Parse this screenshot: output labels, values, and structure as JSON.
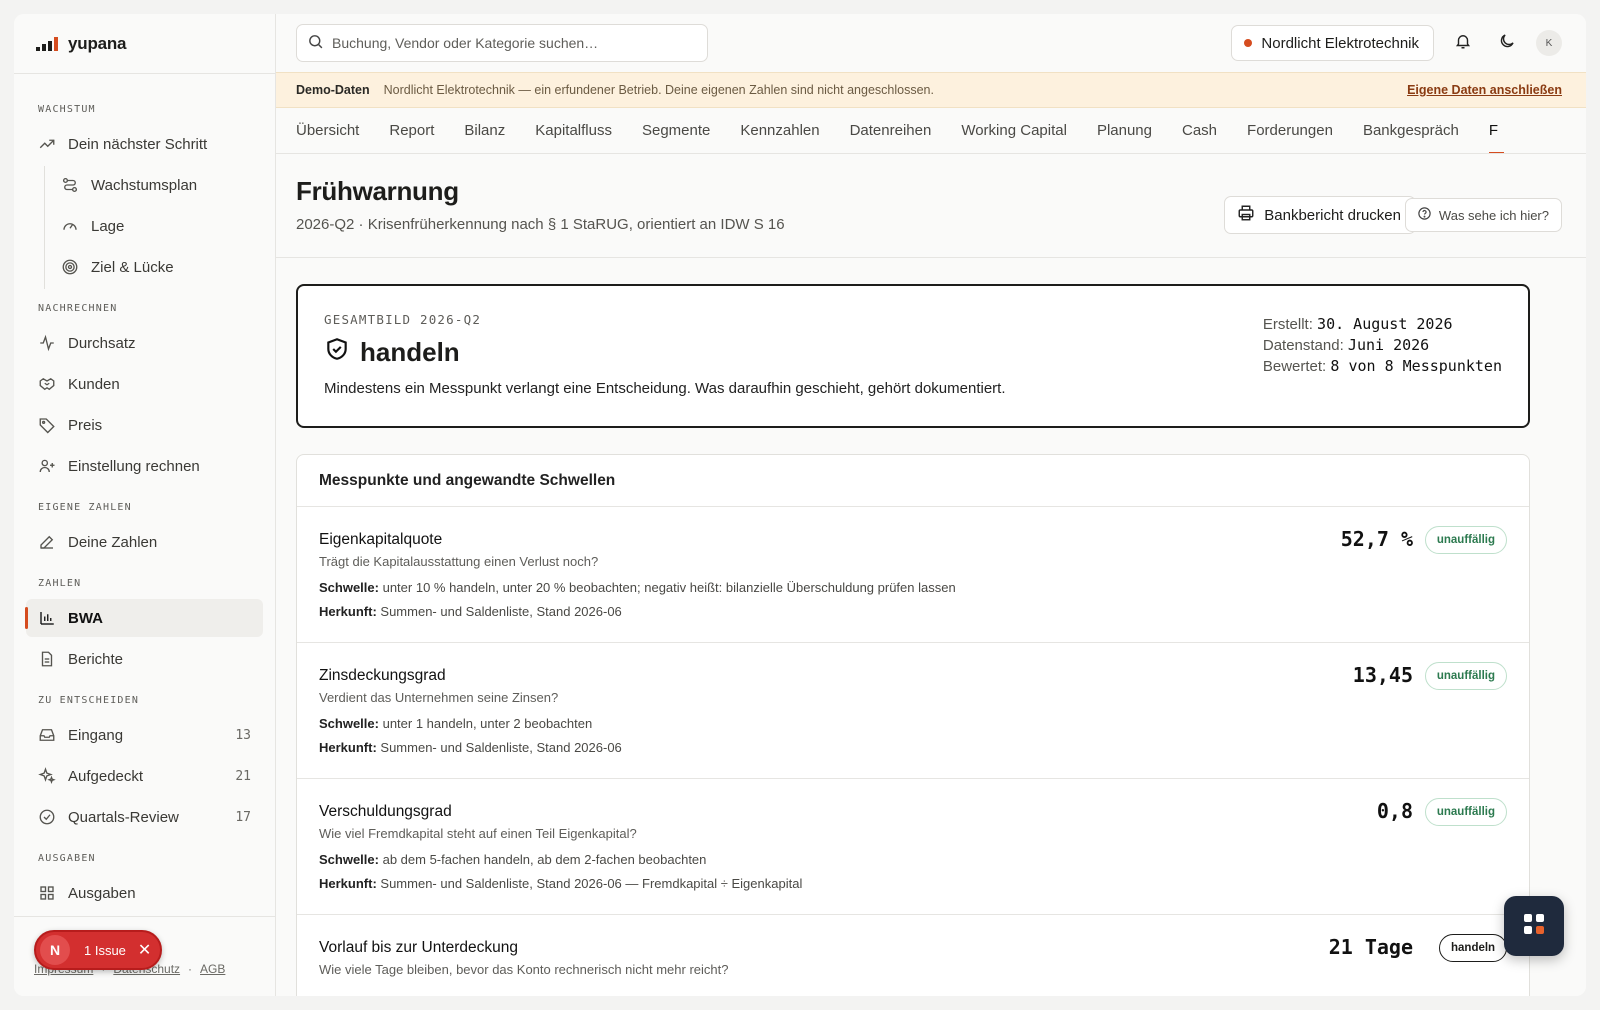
{
  "app": {
    "name": "yupana"
  },
  "search": {
    "placeholder": "Buchung, Vendor oder Kategorie suchen…"
  },
  "company": {
    "name": "Nordlicht Elektrotechnik"
  },
  "user": {
    "initials": "K"
  },
  "banner": {
    "badge": "Demo-Daten",
    "text": "Nordlicht Elektrotechnik — ein erfundener Betrieb. Deine eigenen Zahlen sind nicht angeschlossen.",
    "action": "Eigene Daten anschließen"
  },
  "sidebar": {
    "sections": {
      "wachstum": "WACHSTUM",
      "nachrechnen": "NACHRECHNEN",
      "eigene_zahlen": "EIGENE ZAHLEN",
      "zahlen": "ZAHLEN",
      "zu_entscheiden": "ZU ENTSCHEIDEN",
      "ausgaben": "AUSGABEN"
    },
    "items": {
      "next_step": "Dein nächster Schritt",
      "growth_plan": "Wachstumsplan",
      "lage": "Lage",
      "goal_gap": "Ziel & Lücke",
      "throughput": "Durchsatz",
      "customers": "Kunden",
      "price": "Preis",
      "hiring": "Einstellung rechnen",
      "own_numbers": "Deine Zahlen",
      "bwa": "BWA",
      "reports": "Berichte",
      "inbox": "Eingang",
      "inbox_count": "13",
      "uncovered": "Aufgedeckt",
      "uncovered_count": "21",
      "quarterly_review": "Quartals-Review",
      "quarterly_review_count": "17",
      "expenses": "Ausgaben"
    },
    "footer": {
      "link1": "Impressum",
      "link2": "Datenschutz",
      "sep": "·",
      "link3": "AGB"
    },
    "issue": {
      "letter": "N",
      "label": "1 Issue",
      "close": "✕"
    }
  },
  "tabs": [
    "Übersicht",
    "Report",
    "Bilanz",
    "Kapitalfluss",
    "Segmente",
    "Kennzahlen",
    "Datenreihen",
    "Working Capital",
    "Planung",
    "Cash",
    "Forderungen",
    "Bankgespräch",
    "F"
  ],
  "page": {
    "title": "Frühwarnung",
    "subtitle": "2026-Q2 · Krisenfrüherkennung nach § 1 StaRUG, orientiert an IDW S 16",
    "print_button": "Bankbericht drucken",
    "help_button": "Was sehe ich hier?"
  },
  "summary": {
    "kicker": "GESAMTBILD 2026-Q2",
    "verdict": "handeln",
    "description": "Mindestens ein Messpunkt verlangt eine Entscheidung. Was daraufhin geschieht, gehört dokumentiert.",
    "created_label": "Erstellt:",
    "created_value": "30. August 2026",
    "data_label": "Datenstand:",
    "data_value": "Juni 2026",
    "rated_label": "Bewertet:",
    "rated_value": "8 von 8 Messpunkten"
  },
  "measures": {
    "title": "Messpunkte und angewandte Schwellen",
    "threshold_label": "Schwelle:",
    "origin_label": "Herkunft:",
    "items": [
      {
        "name": "Eigenkapitalquote",
        "question": "Trägt die Kapitalausstattung einen Verlust noch?",
        "threshold": "unter 10 % handeln, unter 20 % beobachten; negativ heißt: bilanzielle Überschuldung prüfen lassen",
        "origin": "Summen- und Saldenliste, Stand 2026-06",
        "value": "52,7 %",
        "status": "unauffällig"
      },
      {
        "name": "Zinsdeckungsgrad",
        "question": "Verdient das Unternehmen seine Zinsen?",
        "threshold": "unter 1 handeln, unter 2 beobachten",
        "origin": "Summen- und Saldenliste, Stand 2026-06",
        "value": "13,45",
        "status": "unauffällig"
      },
      {
        "name": "Verschuldungsgrad",
        "question": "Wie viel Fremdkapital steht auf einen Teil Eigenkapital?",
        "threshold": "ab dem 5-fachen handeln, ab dem 2-fachen beobachten",
        "origin": "Summen- und Saldenliste, Stand 2026-06 — Fremdkapital ÷ Eigenkapital",
        "value": "0,8",
        "status": "unauffällig"
      },
      {
        "name": "Vorlauf bis zur Unterdeckung",
        "question": "Wie viele Tage bleiben, bevor das Konto rechnerisch nicht mehr reicht?",
        "value": "21 Tage",
        "status": "handeln"
      }
    ]
  }
}
